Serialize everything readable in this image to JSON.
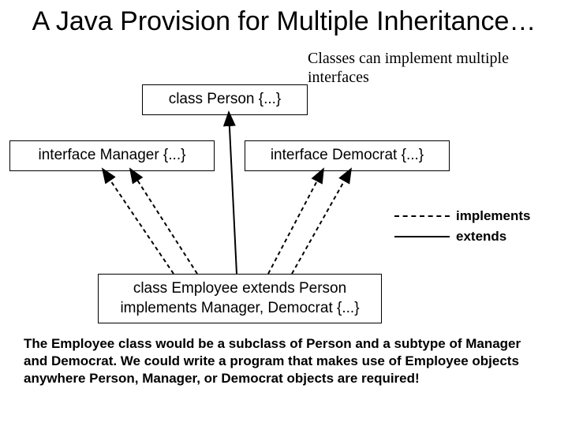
{
  "title": "A Java Provision for Multiple Inheritance…",
  "note": "Classes can implement multiple interfaces",
  "boxes": {
    "person": "class Person {...}",
    "manager": "interface Manager {...}",
    "democrat": "interface Democrat {...}",
    "employee": "class Employee extends Person implements Manager, Democrat {...}"
  },
  "legend": {
    "implements": "implements",
    "extends": "extends"
  },
  "paragraph": "The Employee class would be a subclass of Person and a subtype of Manager and Democrat. We could write a program that makes use of Employee objects anywhere Person, Manager, or Democrat objects are required!"
}
